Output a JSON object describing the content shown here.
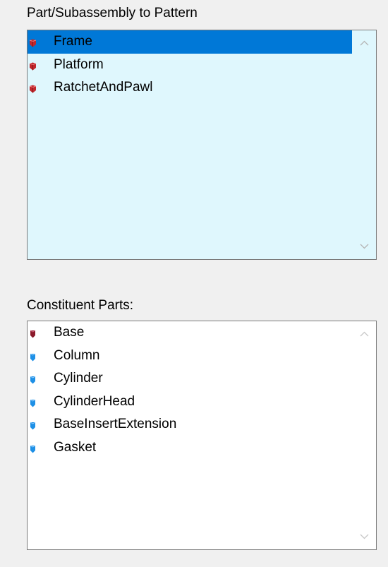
{
  "pattern_section": {
    "label": "Part/Subassembly to Pattern",
    "items": [
      {
        "label": "Frame",
        "icon": "subassembly-red-icon",
        "selected": true
      },
      {
        "label": "Platform",
        "icon": "subassembly-red-icon",
        "selected": false
      },
      {
        "label": "RatchetAndPawl",
        "icon": "subassembly-red-icon",
        "selected": false
      }
    ]
  },
  "constituent_section": {
    "label": "Constituent Parts:",
    "items": [
      {
        "label": "Base",
        "icon": "part-dark-red-icon"
      },
      {
        "label": "Column",
        "icon": "part-blue-icon"
      },
      {
        "label": "Cylinder",
        "icon": "part-blue-icon"
      },
      {
        "label": "CylinderHead",
        "icon": "part-blue-icon"
      },
      {
        "label": "BaseInsertExtension",
        "icon": "part-blue-icon"
      },
      {
        "label": "Gasket",
        "icon": "part-blue-icon"
      }
    ]
  },
  "colors": {
    "pattern_list_bg": "#dff7fd",
    "constituent_list_bg": "#ffffff",
    "selection": "#0078d7",
    "subassembly_icon": "#c0282d",
    "part_dark_icon": "#8b1a2b",
    "part_blue_icon": "#1e90e6"
  }
}
